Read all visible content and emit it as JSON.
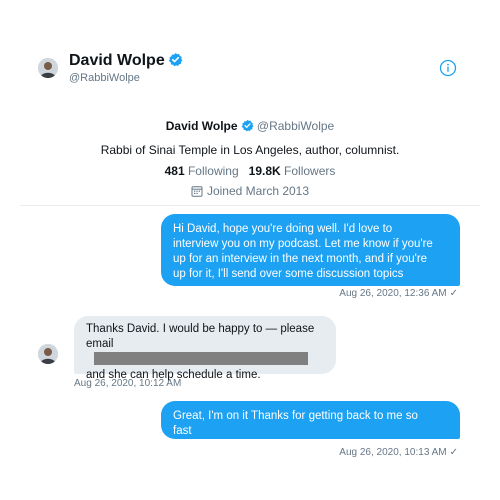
{
  "header": {
    "name": "David Wolpe",
    "handle": "@RabbiWolpe"
  },
  "profile": {
    "name": "David Wolpe",
    "handle": "@RabbiWolpe",
    "bio": "Rabbi of Sinai Temple in Los Angeles, author, columnist.",
    "following_count": "481",
    "following_label": "Following",
    "followers_count": "19.8K",
    "followers_label": "Followers",
    "joined": "Joined March 2013"
  },
  "messages": [
    {
      "direction": "outgoing",
      "lines": [
        "Hi David, hope you're doing well. I'd love to",
        "interview you on my podcast. Let me know if you're",
        "up for an interview in the next month, and if you're",
        "up for it, I'll send over some discussion topics"
      ],
      "timestamp": "Aug 26, 2020, 12:36 AM",
      "read_mark": "✓"
    },
    {
      "direction": "incoming",
      "line1": "Thanks David. I would be happy to — please",
      "line2": "email",
      "line3": "and she can help schedule a time.",
      "timestamp": "Aug 26, 2020, 10:12 AM"
    },
    {
      "direction": "outgoing",
      "lines": [
        "Great, I'm on it Thanks for getting back to me so",
        "fast"
      ],
      "timestamp": "Aug 26, 2020, 10:13 AM",
      "read_mark": "✓"
    }
  ],
  "icons": {
    "verified": "verified-badge-icon",
    "info": "info-icon",
    "calendar": "calendar-icon"
  },
  "colors": {
    "accent": "#1da1f2",
    "incoming_bubble": "#e6ecf0",
    "secondary_text": "#657786",
    "redaction": "#808080"
  }
}
